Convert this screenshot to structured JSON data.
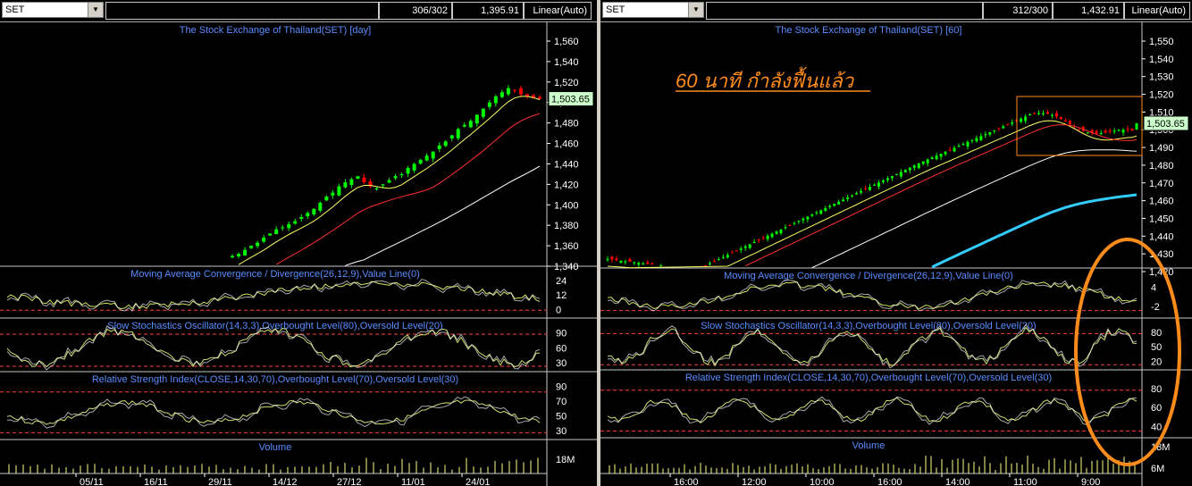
{
  "left": {
    "symbol": "SET",
    "count": "306/302",
    "last": "1,395.91",
    "scale": "Linear(Auto)",
    "title": "The Stock Exchange of Thailand(SET) [day]",
    "price_badge": "1,503.65",
    "macd_title": "Moving Average Convergence / Divergence(26,12,9),Value Line(0)",
    "stoch_title": "Slow Stochastics Oscillator(14,3,3),Overbought Level(80),Oversold Level(20)",
    "rsi_title": "Relative Strength Index(CLOSE,14,30,70),Overbought Level(70),Oversold Level(30)",
    "volume_title": "Volume",
    "volume_tick": "18M",
    "price_ticks": [
      "1,560",
      "1,540",
      "1,520",
      "1,500",
      "1,480",
      "1,460",
      "1,440",
      "1,420",
      "1,400",
      "1,380",
      "1,360",
      "1,340"
    ],
    "macd_ticks": [
      "24",
      "12",
      "0"
    ],
    "stoch_ticks": [
      "90",
      "60",
      "30"
    ],
    "rsi_ticks": [
      "90",
      "70",
      "50",
      "30"
    ],
    "date_ticks": [
      "05/11",
      "16/11",
      "29/11",
      "14/12",
      "27/12",
      "11/01",
      "24/01"
    ]
  },
  "right": {
    "symbol": "SET",
    "count": "312/300",
    "last": "1,432.91",
    "scale": "Linear(Auto)",
    "title": "The Stock Exchange of Thailand(SET) [60]",
    "annotation": "60 นาที กำลังฟื้นแล้ว",
    "price_badge": "1,503.65",
    "macd_title": "Moving Average Convergence / Divergence(26,12,9),Value Line(0)",
    "stoch_title": "Slow Stochastics Oscillator(14,3,3),Overbought Level(80),Oversold Level(20)",
    "rsi_title": "Relative Strength Index(CLOSE,14,30,70),Overbought Level(70),Oversold Level(30)",
    "volume_title": "Volume",
    "volume_ticks": [
      "18M",
      "6M"
    ],
    "price_ticks": [
      "1,550",
      "1,540",
      "1,530",
      "1,520",
      "1,510",
      "1,500",
      "1,490",
      "1,480",
      "1,470",
      "1,460",
      "1,450",
      "1,440",
      "1,430",
      "1,420"
    ],
    "macd_ticks": [
      "4",
      "-2"
    ],
    "stoch_ticks": [
      "80",
      "50",
      "20"
    ],
    "rsi_ticks": [
      "80",
      "60",
      "40"
    ],
    "time_ticks": [
      "16:00",
      "12:00",
      "10:00",
      "16:00",
      "14:00",
      "11:00",
      "9:00"
    ]
  },
  "colors": {
    "bull": "#00ff00",
    "bear": "#ff0000",
    "ma_fast": "#ffff66",
    "ma_mid": "#ff3030",
    "ma_slow": "#ffffff",
    "ma_long": "#33ccff",
    "title": "#5a8cff",
    "axis": "#ffffff",
    "level": "#ff4040",
    "macd": "#d4e060",
    "osc": "#c8e070",
    "volume": "#ffff80",
    "annotation": "#ff8c1a",
    "badge_bg": "#ccffcc"
  },
  "chart_data": [
    {
      "type": "candlestick",
      "title": "The Stock Exchange of Thailand(SET) [day]",
      "ylim": [
        1330,
        1570
      ],
      "last": 1503.65,
      "x_ticks": [
        "05/11",
        "16/11",
        "29/11",
        "14/12",
        "27/12",
        "11/01",
        "24/01"
      ],
      "close": [
        1335,
        1338,
        1342,
        1346,
        1350,
        1352,
        1356,
        1360,
        1363,
        1368,
        1372,
        1376,
        1378,
        1381,
        1384,
        1388,
        1392,
        1396,
        1402,
        1408,
        1412,
        1418,
        1422,
        1425,
        1428,
        1422,
        1418,
        1416,
        1420,
        1424,
        1428,
        1430,
        1436,
        1440,
        1444,
        1448,
        1452,
        1458,
        1462,
        1468,
        1474,
        1478,
        1482,
        1488,
        1494,
        1500,
        1506,
        1510,
        1514,
        1512,
        1508,
        1506,
        1504,
        1503.65
      ]
    },
    {
      "type": "candlestick",
      "title": "The Stock Exchange of Thailand(SET) [60]",
      "ylim": [
        1415,
        1555
      ],
      "last": 1503.65,
      "x_ticks": [
        "16:00",
        "12:00",
        "10:00",
        "16:00",
        "14:00",
        "11:00",
        "9:00"
      ],
      "annotation": "60 นาที กำลังฟื้นแล้ว"
    }
  ]
}
